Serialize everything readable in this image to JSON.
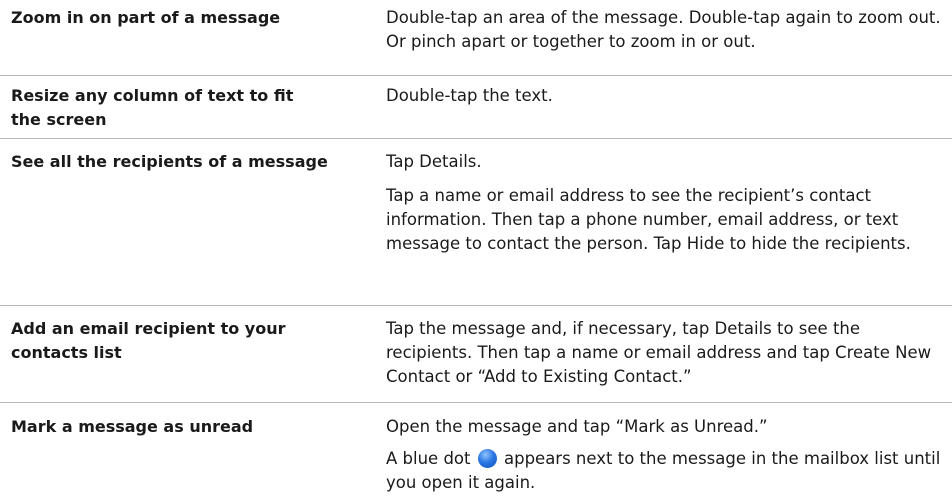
{
  "rows": [
    {
      "task": "Zoom in on part of a message",
      "desc": [
        "Double-tap an area of the message. Double-tap again to zoom out. Or pinch apart or together to zoom in or out."
      ]
    },
    {
      "task": "Resize any column of text to fit the screen",
      "desc": [
        "Double-tap the text."
      ]
    },
    {
      "task": "See all the recipients of a message",
      "desc": [
        "Tap Details.",
        "Tap a name or email address to see the recipient’s contact information. Then tap a phone number, email address, or text message to contact the person. Tap Hide to hide the recipients."
      ]
    },
    {
      "task": "Add an email recipient to your contacts list",
      "desc": [
        "Tap the message and, if necessary, tap Details to see the recipients. Then tap a name or email address and tap Create New Contact or “Add to Existing Contact.”"
      ]
    },
    {
      "task": "Mark a message as unread",
      "desc": [
        "Open the message and tap “Mark as Unread.”"
      ],
      "desc_dot_before": "A blue dot",
      "desc_dot_after": "appears next to the message in the mailbox list until you open it again."
    }
  ],
  "dot_icon": "blue-dot-icon",
  "dot_color": "#2b78e4"
}
